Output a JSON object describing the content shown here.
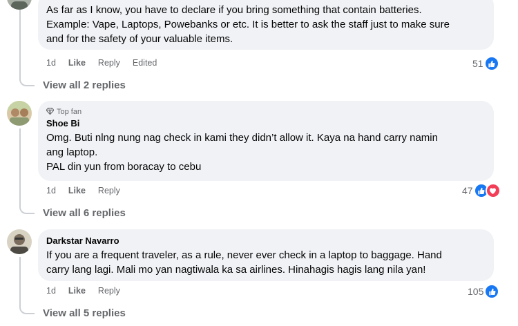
{
  "comments": [
    {
      "author": "",
      "badge": "",
      "lines": [
        "As far as I know, you have to declare if you bring something that contain batteries.",
        "Example: Vape, Laptops, Powebanks or etc. It is better to ask the staff just to make sure",
        "and for the safety of your valuable items."
      ],
      "time": "1d",
      "like_label": "Like",
      "reply_label": "Reply",
      "edited_label": "Edited",
      "reaction_count": "51",
      "reaction_icons": [
        "like-icon"
      ],
      "view_replies": "View all 2 replies"
    },
    {
      "author": "Shoe Bi",
      "badge": "Top fan",
      "lines": [
        "Omg. Buti nlng nung nag check in kami they didn’t allow it. Kaya na hand carry namin",
        "ang laptop.",
        "PAL din yun from boracay to cebu"
      ],
      "time": "1d",
      "like_label": "Like",
      "reply_label": "Reply",
      "reaction_count": "47",
      "reaction_icons": [
        "like-icon",
        "love-icon"
      ],
      "view_replies": "View all 6 replies"
    },
    {
      "author": "Darkstar Navarro",
      "badge": "",
      "lines": [
        "If you are a frequent traveler, as a rule, never ever check in a laptop to baggage. Hand",
        "carry lang lagi. Mali mo yan nagtiwala ka sa airlines. Hinahagis hagis lang nila yan!"
      ],
      "time": "1d",
      "like_label": "Like",
      "reply_label": "Reply",
      "reaction_count": "105",
      "reaction_icons": [
        "like-icon"
      ],
      "view_replies": "View all 5 replies"
    }
  ],
  "colors": {
    "bubble": "#f0f2f5",
    "meta_text": "#65676b",
    "like_blue": "#1877f2",
    "love_red": "#f33e58"
  }
}
